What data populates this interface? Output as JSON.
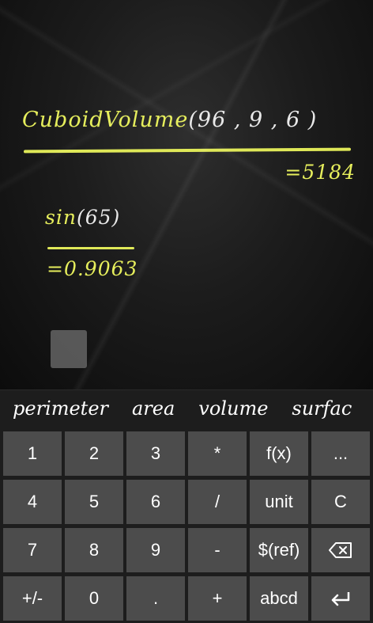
{
  "history": [
    {
      "fn": "CuboidVolume",
      "args": "(96 , 9 , 6 )",
      "result": "=5184"
    },
    {
      "fn": "sin",
      "args": "(65)",
      "result": "=0.9063"
    }
  ],
  "suggestions": [
    "perimeter",
    "area",
    "volume",
    "surfac"
  ],
  "keypad": {
    "rows": [
      [
        "1",
        "2",
        "3",
        "*",
        "f(x)",
        "..."
      ],
      [
        "4",
        "5",
        "6",
        "/",
        "unit",
        "C"
      ],
      [
        "7",
        "8",
        "9",
        "-",
        "$(ref)",
        ""
      ],
      [
        "+/-",
        "0",
        ".",
        "+",
        "abcd",
        ""
      ]
    ],
    "icons": {
      "backspace": "backspace-icon",
      "enter": "enter-icon"
    }
  },
  "colors": {
    "chalk_yellow": "#e6ee5c",
    "chalk_white": "#e9e9e9",
    "key_bg": "#4c4c4c",
    "keyboard_bg": "#1d1d1d"
  }
}
